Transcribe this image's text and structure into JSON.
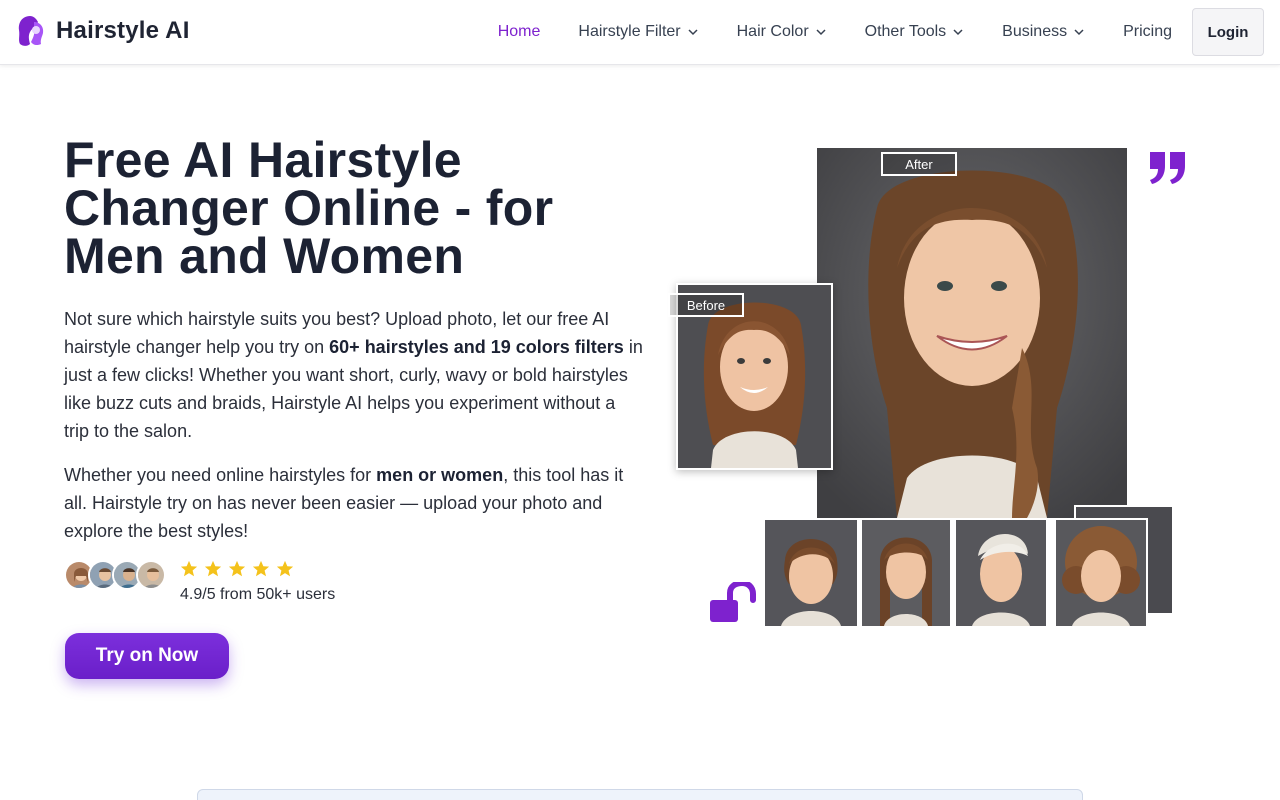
{
  "brand": {
    "name": "Hairstyle AI",
    "accent": "#7e22ce",
    "logo_icon": "woman-profile-logo-icon"
  },
  "nav": {
    "items": [
      {
        "label": "Home",
        "active": true,
        "dropdown": false
      },
      {
        "label": "Hairstyle Filter",
        "dropdown": true
      },
      {
        "label": "Hair Color",
        "dropdown": true
      },
      {
        "label": "Other Tools",
        "dropdown": true
      },
      {
        "label": "Business",
        "dropdown": true
      },
      {
        "label": "Pricing",
        "dropdown": false
      }
    ],
    "login_label": "Login"
  },
  "hero": {
    "title": "Free AI Hairstyle Changer Online - for Men and Women",
    "p1_a": "Not sure which hairstyle suits you best? Upload photo, let our free AI hairstyle changer help you try on ",
    "p1_bold": "60+ hairstyles and 19 colors filters",
    "p1_b": " in just a few clicks! Whether you want short, curly, wavy or bold hairstyles like buzz cuts and braids, Hairstyle AI helps you experiment without a trip to the salon.",
    "p2_a": "Whether you need online hairstyles for ",
    "p2_bold": "men or women",
    "p2_b": ", this tool has it all. Hairstyle try on has never been easier — upload your photo and explore the best styles!",
    "rating_text": "4.9/5 from 50k+ users",
    "rating_value": 4.9,
    "stars": 5,
    "star_color": "#f4c21b",
    "cta_label": "Try on Now"
  },
  "visual": {
    "after_label": "After",
    "before_label": "Before",
    "quote_icon": "quote-icon",
    "lock_icon": "unlock-icon",
    "thumbs": [
      "short-pixie",
      "braids",
      "platinum-undercut",
      "curly-bob"
    ]
  }
}
